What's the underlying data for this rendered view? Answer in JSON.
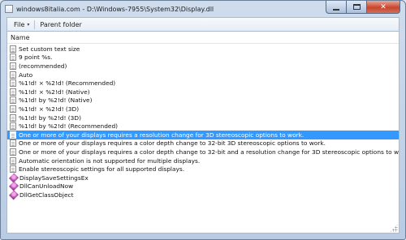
{
  "window": {
    "title": "windows8italia.com - D:\\Windows-7955\\System32\\Display.dll",
    "minimize_label": "",
    "maximize_label": "",
    "close_label": "✕"
  },
  "menubar": {
    "file_label": "File",
    "file_arrow": "▾",
    "parent_folder_label": "Parent folder"
  },
  "list": {
    "column_header": "Name",
    "items": [
      {
        "label": "Set custom text size",
        "type": "string",
        "selected": false
      },
      {
        "label": "9 point %s.",
        "type": "string",
        "selected": false
      },
      {
        "label": "(recommended)",
        "type": "string",
        "selected": false
      },
      {
        "label": "Auto",
        "type": "string",
        "selected": false
      },
      {
        "label": "%1!d! × %2!d! (Recommended)",
        "type": "string",
        "selected": false
      },
      {
        "label": "%1!d! × %2!d! (Native)",
        "type": "string",
        "selected": false
      },
      {
        "label": "%1!d! by %2!d! (Native)",
        "type": "string",
        "selected": false
      },
      {
        "label": "%1!d! × %2!d! (3D)",
        "type": "string",
        "selected": false
      },
      {
        "label": "%1!d! by %2!d! (3D)",
        "type": "string",
        "selected": false
      },
      {
        "label": "%1!d! by %2!d! (Recommended)",
        "type": "string",
        "selected": false
      },
      {
        "label": "One or more of your displays requires a resolution change for 3D stereoscopic options to work.",
        "type": "string",
        "selected": true
      },
      {
        "label": "One or more of your displays requires a color depth change to 32-bit 3D stereoscopic options to work.",
        "type": "string",
        "selected": false
      },
      {
        "label": "One or more of your displays requires a color depth change to 32-bit and a resolution change for 3D stereoscopic options to work.",
        "type": "string",
        "selected": false
      },
      {
        "label": "Automatic orientation is not supported for multiple displays.",
        "type": "string",
        "selected": false
      },
      {
        "label": "Enable stereoscopic settings for all supported displays.",
        "type": "string",
        "selected": false
      },
      {
        "label": "DisplaySaveSettingsEx",
        "type": "function",
        "selected": false
      },
      {
        "label": "DllCanUnloadNow",
        "type": "function",
        "selected": false
      },
      {
        "label": "DllGetClassObject",
        "type": "function",
        "selected": false
      }
    ]
  },
  "colors": {
    "selection": "#3399ff",
    "window_frame": "#b9cce3",
    "close_button": "#c9452c"
  },
  "icons": {
    "string_item": "document-icon",
    "function_item": "function-icon",
    "app": "app-icon"
  }
}
